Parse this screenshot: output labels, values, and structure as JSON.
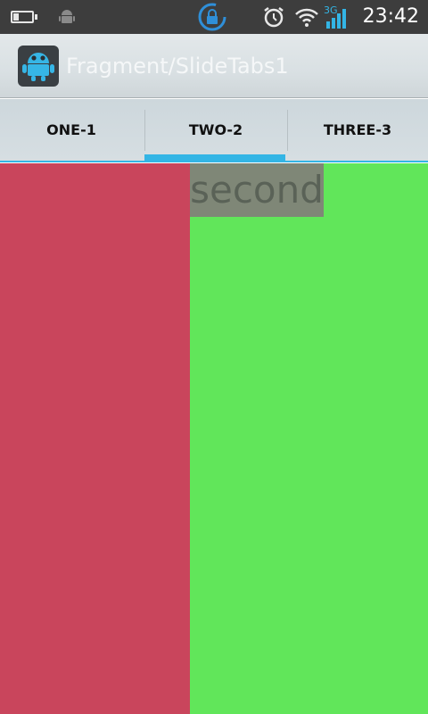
{
  "status_bar": {
    "time": "23:42",
    "network_type": "3G",
    "icons": [
      "battery-icon",
      "android-icon",
      "sync-lock-icon",
      "alarm-icon",
      "wifi-icon",
      "signal-icon"
    ]
  },
  "action_bar": {
    "title": "Fragment/SlideTabs1",
    "icon": "android-robot-icon"
  },
  "tabs": [
    {
      "label": "ONE-1",
      "selected": false
    },
    {
      "label": "TWO-2",
      "selected": true
    },
    {
      "label": "THREE-3",
      "selected": false
    }
  ],
  "content": {
    "label": "second"
  },
  "colors": {
    "accent": "#33b5e5",
    "pane_left": "#c9455c",
    "pane_right": "#61e65a"
  }
}
